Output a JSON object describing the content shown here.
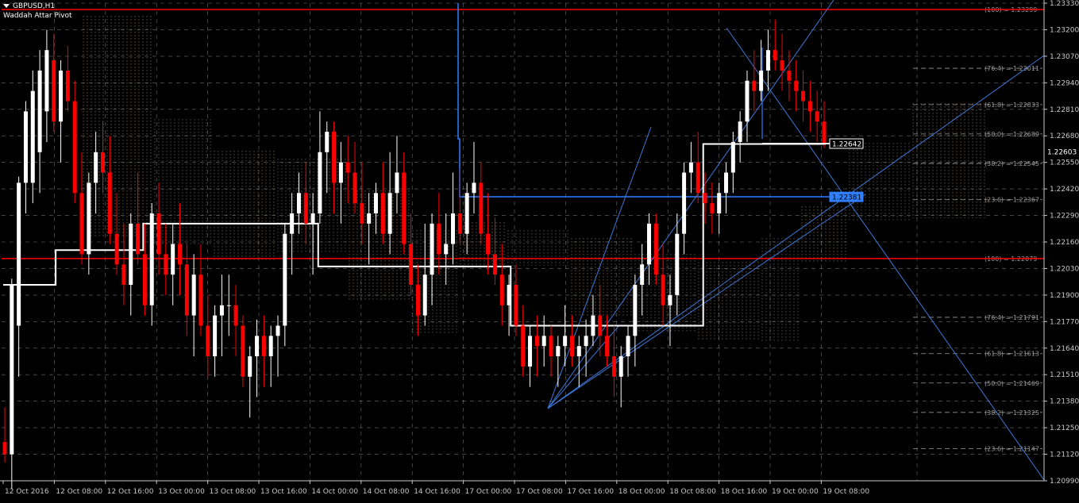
{
  "window": {
    "symbol_label": "GBPUSD,H1",
    "indicator_label": "Waddah Attar Pivot"
  },
  "colors": {
    "background": "#000000",
    "bull_candle": "#ffffff",
    "bear_candle": "#ff0000",
    "grid": "#c8c8c8",
    "horizontal_line": "#ff0000",
    "fib_line": "#3f78d8",
    "box_line": "#2f7fff",
    "pivot_line": "#ffffff",
    "cloud_a": "#c8a27a",
    "cloud_b": "#9a9a9a",
    "axis_text": "#c8c8c8"
  },
  "price_axis": {
    "ticks": [
      "1.23330",
      "1.23200",
      "1.23070",
      "1.22940",
      "1.22810",
      "1.22680",
      "1.22550",
      "1.22420",
      "1.22290",
      "1.22160",
      "1.22030",
      "1.21900",
      "1.21770",
      "1.21640",
      "1.21510",
      "1.21380",
      "1.21250",
      "1.21120",
      "1.20990"
    ],
    "max": 1.2333,
    "min": 1.2099
  },
  "time_axis": {
    "labels": [
      "12 Oct 2016",
      "12 Oct 08:00",
      "12 Oct 16:00",
      "13 Oct 00:00",
      "13 Oct 08:00",
      "13 Oct 16:00",
      "14 Oct 00:00",
      "14 Oct 08:00",
      "14 Oct 16:00",
      "17 Oct 00:00",
      "17 Oct 08:00",
      "17 Oct 16:00",
      "18 Oct 00:00",
      "18 Oct 08:00",
      "18 Oct 16:00",
      "19 Oct 00:00",
      "19 Oct 08:00"
    ]
  },
  "price_tags": [
    {
      "text": "1.22642",
      "price": 1.22642,
      "style": "white"
    },
    {
      "text": "1.22603",
      "price": 1.22603,
      "style": "plain"
    },
    {
      "text": "1.22381",
      "price": 1.22381,
      "style": "blue"
    }
  ],
  "fib_levels": [
    {
      "label": "(100) = 1.23299",
      "price": 1.23299
    },
    {
      "label": "(76.4) = 1.23011",
      "price": 1.23011
    },
    {
      "label": "(61.8) = 1.22833",
      "price": 1.22833
    },
    {
      "label": "(50.0) = 1.22689",
      "price": 1.22689
    },
    {
      "label": "(38.2) = 1.22545",
      "price": 1.22545
    },
    {
      "label": "(23.6) = 1.22367",
      "price": 1.22367
    },
    {
      "label": "(100) = 1.22079",
      "price": 1.22079
    },
    {
      "label": "(76.4) = 1.21791",
      "price": 1.21791
    },
    {
      "label": "(61.8) = 1.21613",
      "price": 1.21613
    },
    {
      "label": "(50.0) = 1.21469",
      "price": 1.21469
    },
    {
      "label": "(38.2) = 1.21325",
      "price": 1.21325
    },
    {
      "label": "(23.6) = 1.21147",
      "price": 1.21147
    }
  ],
  "red_lines": [
    1.23299,
    1.22079
  ],
  "candles": [
    [
      1.2118,
      1.2135,
      1.2108,
      1.2112
    ],
    [
      1.2112,
      1.2198,
      1.2095,
      1.2195
    ],
    [
      1.2175,
      1.2248,
      1.215,
      1.2245
    ],
    [
      1.2245,
      1.2285,
      1.223,
      1.228
    ],
    [
      1.2245,
      1.23,
      1.2235,
      1.229
    ],
    [
      1.226,
      1.231,
      1.224,
      1.23
    ],
    [
      1.228,
      1.232,
      1.2265,
      1.231
    ],
    [
      1.2305,
      1.2318,
      1.227,
      1.2275
    ],
    [
      1.2275,
      1.2305,
      1.2255,
      1.23
    ],
    [
      1.23,
      1.2312,
      1.228,
      1.2285
    ],
    [
      1.2285,
      1.2295,
      1.2235,
      1.224
    ],
    [
      1.224,
      1.226,
      1.2205,
      1.221
    ],
    [
      1.221,
      1.225,
      1.22,
      1.2245
    ],
    [
      1.2245,
      1.227,
      1.223,
      1.226
    ],
    [
      1.226,
      1.2275,
      1.224,
      1.225
    ],
    [
      1.225,
      1.2268,
      1.2215,
      1.222
    ],
    [
      1.222,
      1.224,
      1.22,
      1.2205
    ],
    [
      1.2205,
      1.2225,
      1.2185,
      1.2195
    ],
    [
      1.2195,
      1.223,
      1.218,
      1.2225
    ],
    [
      1.2225,
      1.225,
      1.2205,
      1.221
    ],
    [
      1.221,
      1.2225,
      1.218,
      1.2185
    ],
    [
      1.2185,
      1.2235,
      1.2175,
      1.223
    ],
    [
      1.223,
      1.2245,
      1.22,
      1.221
    ],
    [
      1.221,
      1.2225,
      1.219,
      1.22
    ],
    [
      1.22,
      1.2225,
      1.2185,
      1.2215
    ],
    [
      1.2215,
      1.2235,
      1.219,
      1.2205
    ],
    [
      1.2205,
      1.2215,
      1.217,
      1.218
    ],
    [
      1.218,
      1.221,
      1.216,
      1.22
    ],
    [
      1.22,
      1.2215,
      1.217,
      1.2175
    ],
    [
      1.2175,
      1.219,
      1.215,
      1.216
    ],
    [
      1.216,
      1.2185,
      1.215,
      1.218
    ],
    [
      1.218,
      1.22,
      1.216,
      1.2185
    ],
    [
      1.2185,
      1.22,
      1.217,
      1.2185
    ],
    [
      1.2185,
      1.2195,
      1.216,
      1.2175
    ],
    [
      1.2175,
      1.218,
      1.2145,
      1.215
    ],
    [
      1.215,
      1.2165,
      1.213,
      1.216
    ],
    [
      1.216,
      1.2178,
      1.214,
      1.217
    ],
    [
      1.217,
      1.218,
      1.2145,
      1.216
    ],
    [
      1.216,
      1.2175,
      1.2145,
      1.217
    ],
    [
      1.217,
      1.218,
      1.215,
      1.2175
    ],
    [
      1.2175,
      1.2225,
      1.2165,
      1.222
    ],
    [
      1.222,
      1.224,
      1.22,
      1.223
    ],
    [
      1.223,
      1.225,
      1.222,
      1.224
    ],
    [
      1.224,
      1.2255,
      1.2215,
      1.2225
    ],
    [
      1.2225,
      1.224,
      1.22,
      1.223
    ],
    [
      1.223,
      1.228,
      1.2225,
      1.226
    ],
    [
      1.226,
      1.2275,
      1.224,
      1.227
    ],
    [
      1.227,
      1.2275,
      1.223,
      1.2245
    ],
    [
      1.2245,
      1.2265,
      1.2225,
      1.2255
    ],
    [
      1.2255,
      1.2268,
      1.2235,
      1.225
    ],
    [
      1.225,
      1.2265,
      1.223,
      1.2235
    ],
    [
      1.2235,
      1.2255,
      1.2215,
      1.2225
    ],
    [
      1.2225,
      1.224,
      1.2205,
      1.223
    ],
    [
      1.223,
      1.2245,
      1.222,
      1.224
    ],
    [
      1.224,
      1.2255,
      1.2215,
      1.222
    ],
    [
      1.222,
      1.226,
      1.221,
      1.224
    ],
    [
      1.224,
      1.2268,
      1.223,
      1.225
    ],
    [
      1.225,
      1.226,
      1.221,
      1.2215
    ],
    [
      1.2215,
      1.223,
      1.219,
      1.2195
    ],
    [
      1.2195,
      1.2205,
      1.217,
      1.218
    ],
    [
      1.218,
      1.2225,
      1.2175,
      1.22
    ],
    [
      1.22,
      1.223,
      1.2185,
      1.2225
    ],
    [
      1.2225,
      1.224,
      1.22,
      1.221
    ],
    [
      1.221,
      1.223,
      1.2195,
      1.2215
    ],
    [
      1.2215,
      1.225,
      1.2205,
      1.223
    ],
    [
      1.223,
      1.2252,
      1.2215,
      1.222
    ],
    [
      1.222,
      1.2245,
      1.221,
      1.224
    ],
    [
      1.224,
      1.2265,
      1.223,
      1.2245
    ],
    [
      1.2245,
      1.2255,
      1.2215,
      1.222
    ],
    [
      1.222,
      1.224,
      1.22,
      1.221
    ],
    [
      1.221,
      1.2228,
      1.2195,
      1.22
    ],
    [
      1.22,
      1.2215,
      1.2175,
      1.2185
    ],
    [
      1.2185,
      1.22,
      1.217,
      1.2195
    ],
    [
      1.2195,
      1.2205,
      1.217,
      1.2175
    ],
    [
      1.2175,
      1.2185,
      1.215,
      1.2155
    ],
    [
      1.2155,
      1.2175,
      1.2145,
      1.217
    ],
    [
      1.217,
      1.218,
      1.215,
      1.2165
    ],
    [
      1.2165,
      1.218,
      1.2155,
      1.217
    ],
    [
      1.217,
      1.2175,
      1.215,
      1.216
    ],
    [
      1.216,
      1.217,
      1.2145,
      1.2165
    ],
    [
      1.2165,
      1.2185,
      1.2155,
      1.217
    ],
    [
      1.217,
      1.218,
      1.2155,
      1.216
    ],
    [
      1.216,
      1.217,
      1.2145,
      1.2165
    ],
    [
      1.2165,
      1.2178,
      1.215,
      1.217
    ],
    [
      1.217,
      1.219,
      1.2165,
      1.218
    ],
    [
      1.218,
      1.2195,
      1.216,
      1.217
    ],
    [
      1.217,
      1.218,
      1.2155,
      1.216
    ],
    [
      1.216,
      1.2175,
      1.214,
      1.215
    ],
    [
      1.215,
      1.2165,
      1.2135,
      1.216
    ],
    [
      1.216,
      1.2175,
      1.215,
      1.217
    ],
    [
      1.217,
      1.22,
      1.2155,
      1.2195
    ],
    [
      1.2195,
      1.2215,
      1.218,
      1.2205
    ],
    [
      1.2205,
      1.223,
      1.2195,
      1.2225
    ],
    [
      1.2225,
      1.223,
      1.2195,
      1.22
    ],
    [
      1.22,
      1.2215,
      1.2175,
      1.2185
    ],
    [
      1.2185,
      1.22,
      1.2165,
      1.219
    ],
    [
      1.219,
      1.223,
      1.218,
      1.222
    ],
    [
      1.222,
      1.2255,
      1.221,
      1.225
    ],
    [
      1.225,
      1.2265,
      1.224,
      1.2255
    ],
    [
      1.2255,
      1.227,
      1.2235,
      1.224
    ],
    [
      1.224,
      1.225,
      1.2225,
      1.2235
    ],
    [
      1.2235,
      1.2245,
      1.222,
      1.223
    ],
    [
      1.223,
      1.2245,
      1.222,
      1.224
    ],
    [
      1.224,
      1.2255,
      1.223,
      1.225
    ],
    [
      1.225,
      1.227,
      1.224,
      1.2265
    ],
    [
      1.2265,
      1.228,
      1.2255,
      1.2275
    ],
    [
      1.2275,
      1.23,
      1.2265,
      1.2295
    ],
    [
      1.2295,
      1.231,
      1.228,
      1.229
    ],
    [
      1.229,
      1.2315,
      1.2285,
      1.23
    ],
    [
      1.23,
      1.232,
      1.229,
      1.231
    ],
    [
      1.231,
      1.2325,
      1.23,
      1.2305
    ],
    [
      1.2305,
      1.2318,
      1.229,
      1.23
    ],
    [
      1.23,
      1.231,
      1.2285,
      1.2295
    ],
    [
      1.2295,
      1.2305,
      1.228,
      1.229
    ],
    [
      1.229,
      1.23,
      1.2275,
      1.2285
    ],
    [
      1.2285,
      1.2295,
      1.227,
      1.228
    ],
    [
      1.228,
      1.229,
      1.2265,
      1.2275
    ],
    [
      1.2275,
      1.2285,
      1.2262,
      1.2264
    ]
  ],
  "pivot_steps": [
    [
      1.2195,
      1.2195,
      1.2195,
      1.2212,
      1.2212,
      1.2212,
      1.2212,
      1.2212,
      1.2225,
      1.2225,
      1.2225,
      1.2225,
      1.2225,
      1.2225,
      1.2225,
      1.2225,
      1.2225,
      1.2225,
      1.2204,
      1.2204,
      1.2204,
      1.2204,
      1.2204,
      1.2204,
      1.2204,
      1.2204,
      1.2204,
      1.2204,
      1.2204,
      1.2175,
      1.2175,
      1.2175,
      1.2175,
      1.2175,
      1.2175,
      1.2175,
      1.2175,
      1.2175,
      1.2175,
      1.2175,
      1.2264,
      1.2264,
      1.2264,
      1.2264,
      1.2264,
      1.2264,
      1.2264,
      1.2264
    ]
  ]
}
